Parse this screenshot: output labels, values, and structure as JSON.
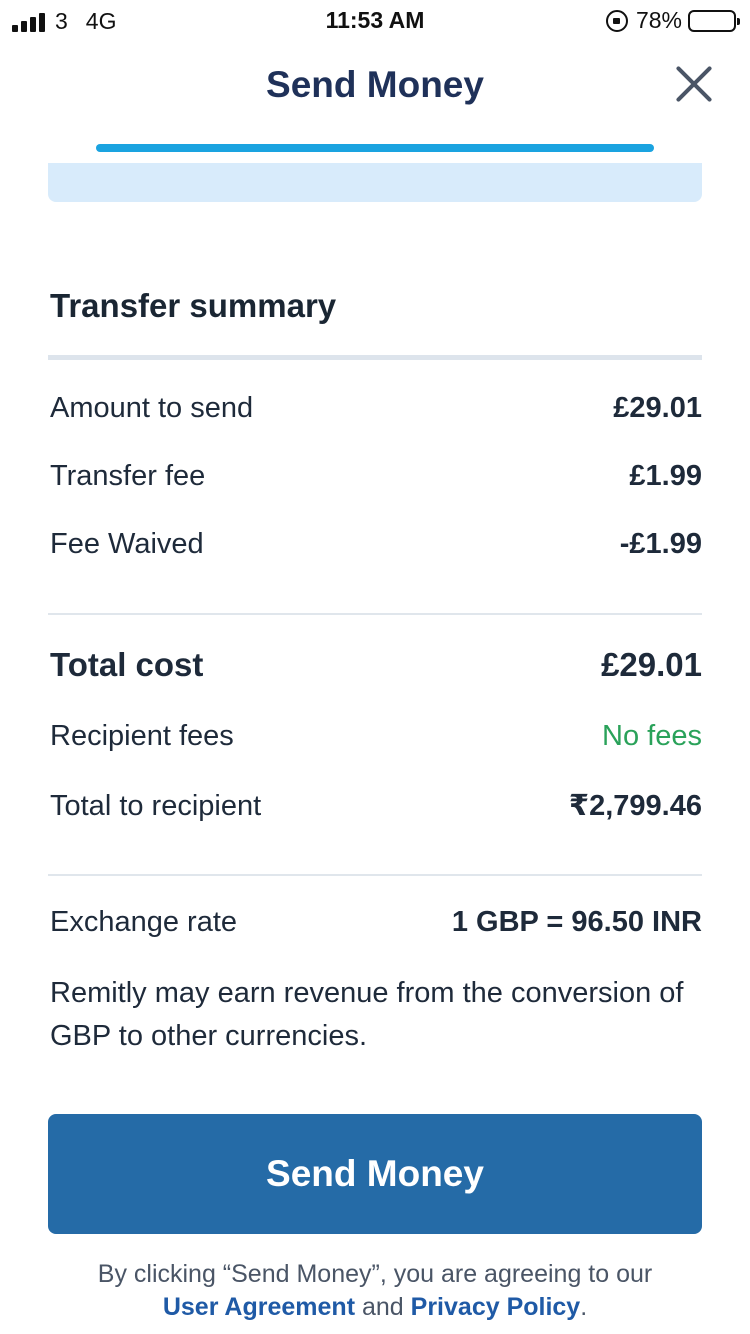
{
  "status_bar": {
    "carrier": "3",
    "network": "4G",
    "time": "11:53 AM",
    "battery": "78%",
    "battery_level": 0.78
  },
  "header": {
    "title": "Send Money",
    "close_icon": "close-icon",
    "progress": 1.0
  },
  "summary": {
    "title": "Transfer summary",
    "rows": [
      {
        "label": "Amount to send",
        "value": "£29.01"
      },
      {
        "label": "Transfer fee",
        "value": "£1.99"
      },
      {
        "label": "Fee Waived",
        "value": "-£1.99"
      }
    ],
    "total_cost": {
      "label": "Total cost",
      "value": "£29.01"
    },
    "recipient_fees": {
      "label": "Recipient fees",
      "value": "No fees"
    },
    "total_to_recipient": {
      "label": "Total to recipient",
      "value": "₹2,799.46"
    },
    "exchange_rate": {
      "label": "Exchange rate",
      "value": "1 GBP = 96.50 INR"
    },
    "disclaimer": "Remitly may earn revenue from the conversion of GBP to other currencies."
  },
  "send_button": {
    "label": "Send Money"
  },
  "footer": {
    "prefix": "By clicking “Send Money”, you are agreeing to our",
    "link1": "User Agreement",
    "and": "and",
    "link2": "Privacy Policy",
    "suffix": "."
  },
  "colors": {
    "primary_button": "#256ba7",
    "progress": "#1aa3e0",
    "header_title": "#1f3159",
    "green": "#2aa25a",
    "info_card": "#d8ebfb"
  }
}
